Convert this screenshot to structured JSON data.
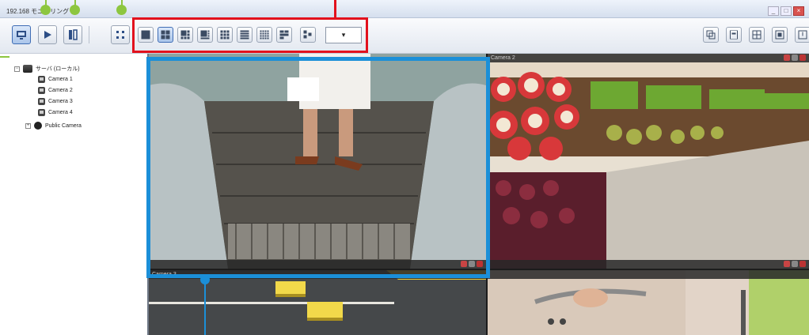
{
  "window": {
    "title": "192.168 モニタリング",
    "controls": [
      "minimize",
      "maximize",
      "close"
    ]
  },
  "toolbar": {
    "left_buttons": [
      {
        "name": "live-view-button",
        "icon": "monitor-icon",
        "active": true
      },
      {
        "name": "playback-button",
        "icon": "play-icon",
        "active": false
      },
      {
        "name": "search-playback-button",
        "icon": "film-search-icon",
        "active": false
      },
      {
        "name": "fullscreen-button",
        "icon": "expand-icon",
        "active": false
      }
    ],
    "layout_buttons": [
      {
        "name": "layout-1x1",
        "icon": "layout-1-icon",
        "active": false
      },
      {
        "name": "layout-2x2",
        "icon": "layout-4-icon",
        "active": true
      },
      {
        "name": "layout-1p5",
        "icon": "layout-6-icon",
        "active": false
      },
      {
        "name": "layout-1p7",
        "icon": "layout-8-icon",
        "active": false
      },
      {
        "name": "layout-3x3",
        "icon": "layout-9-icon",
        "active": false
      },
      {
        "name": "layout-1p12",
        "icon": "layout-13-icon",
        "active": false
      },
      {
        "name": "layout-4x4",
        "icon": "layout-16-icon",
        "active": false
      },
      {
        "name": "layout-custom",
        "icon": "layout-custom-icon",
        "active": false
      }
    ],
    "zoom_select": {
      "value": "▾"
    },
    "right_buttons": [
      {
        "name": "window-mode-button",
        "icon": "windows-icon"
      },
      {
        "name": "device-button",
        "icon": "device-icon"
      },
      {
        "name": "map-button",
        "icon": "grid-icon"
      },
      {
        "name": "settings-button",
        "icon": "display-icon"
      },
      {
        "name": "exit-button",
        "icon": "power-icon"
      }
    ]
  },
  "tree": {
    "server": {
      "label": "サーバ (ローカル)",
      "expander": "−"
    },
    "cameras": [
      {
        "label": "Camera 1"
      },
      {
        "label": "Camera 2"
      },
      {
        "label": "Camera 3"
      },
      {
        "label": "Camera 4"
      }
    ],
    "public_camera": {
      "label": "Public Camera",
      "expander": "+"
    }
  },
  "tiles": [
    {
      "label": "",
      "scene": "escalator"
    },
    {
      "label": "Camera 2",
      "scene": "produce"
    },
    {
      "label": "Camera 3",
      "scene": "parking"
    },
    {
      "label": "",
      "scene": "cart"
    }
  ],
  "colors": {
    "highlight_red": "#e2111d",
    "highlight_green": "#8dc63f",
    "highlight_blue": "#1b8fd8",
    "toolbar_active": "#3f6db5"
  }
}
